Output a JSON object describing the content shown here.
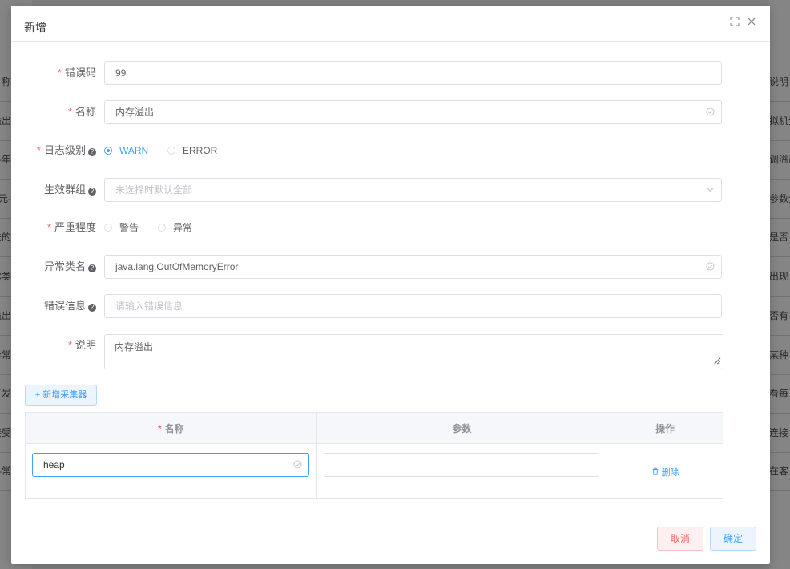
{
  "background": {
    "left_rows": [
      "称",
      "溢出",
      "存-年",
      "-元",
      "法的",
      "GC类",
      "溢出",
      "异常",
      "开发",
      "接受",
      "常-"
    ],
    "right_rows": [
      "说明",
      "拟机无",
      "调溢出",
      "参数元",
      "是否",
      "出现",
      "否有",
      "某种",
      "看每",
      "连接",
      "在客"
    ]
  },
  "modal": {
    "title": "新增",
    "fields": {
      "error_code": {
        "label": "错误码",
        "value": "99"
      },
      "name": {
        "label": "名称",
        "value": "内存溢出"
      },
      "log_level": {
        "label": "日志级别",
        "options": [
          "WARN",
          "ERROR"
        ],
        "selected": "WARN"
      },
      "group": {
        "label": "生效群组",
        "placeholder": "未选择时默认全部"
      },
      "severity": {
        "label": "严重程度",
        "options": [
          "警告",
          "异常"
        ]
      },
      "exception_class": {
        "label": "异常类名",
        "value": "java.lang.OutOfMemoryError"
      },
      "error_message": {
        "label": "错误信息",
        "placeholder": "请输入错误信息"
      },
      "description": {
        "label": "说明",
        "value": "内存溢出"
      }
    },
    "add_collector_label": "新增采集器",
    "table": {
      "headers": [
        "名称",
        "参数",
        "操作"
      ],
      "rows": [
        {
          "name": "heap",
          "param": "",
          "action": "删除"
        }
      ]
    },
    "buttons": {
      "cancel": "取消",
      "ok": "确定"
    }
  },
  "colors": {
    "primary": "#409eff",
    "danger": "#f56c6c",
    "required": "#f56c6c"
  }
}
